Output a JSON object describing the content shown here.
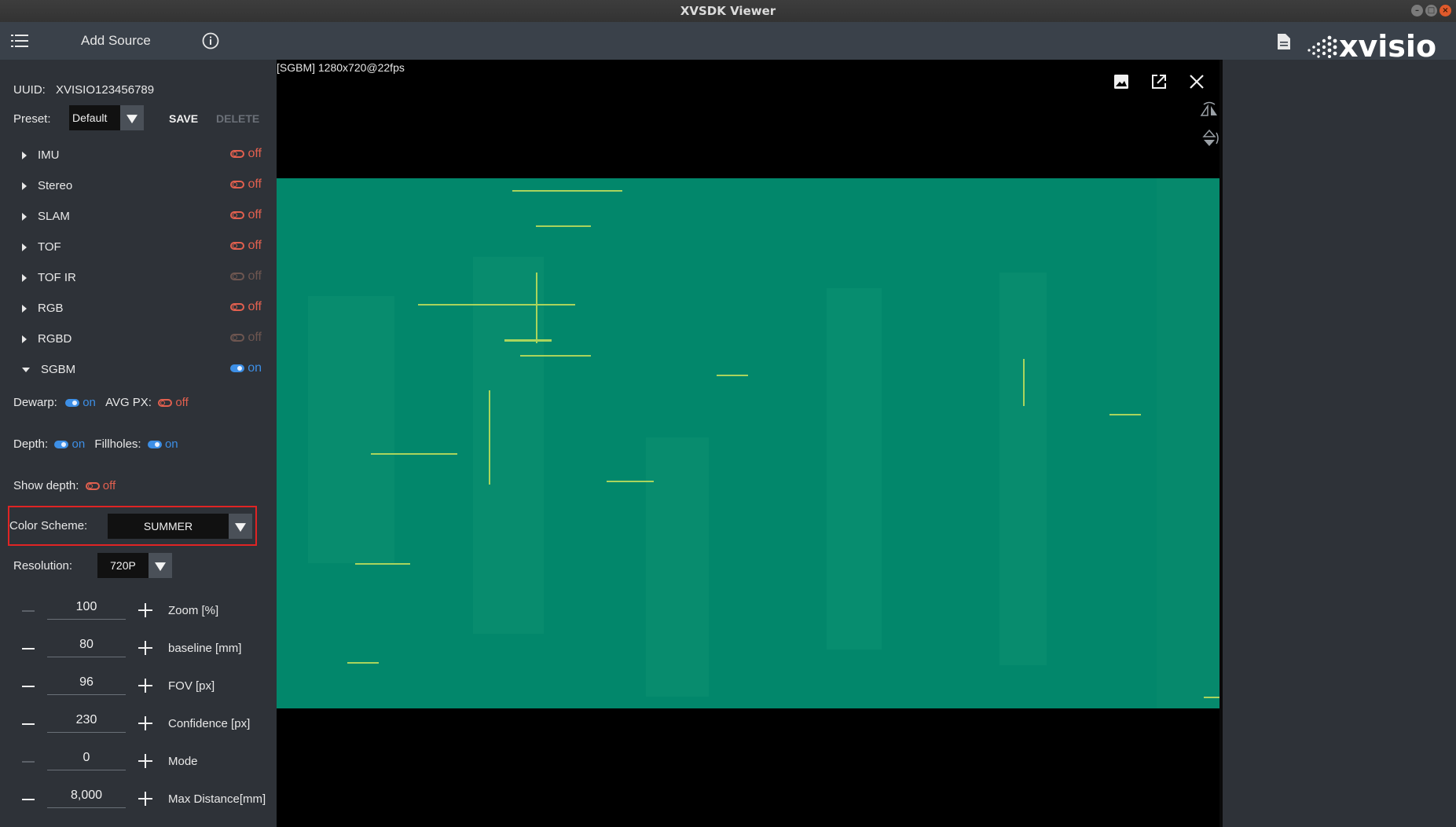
{
  "window": {
    "title": "XVSDK Viewer"
  },
  "toolbar": {
    "add_source_label": "Add Source",
    "brand": "xvisio"
  },
  "device": {
    "uuid_label": "UUID:",
    "uuid_value": "XVISIO123456789"
  },
  "preset": {
    "label": "Preset:",
    "value": "Default",
    "save_label": "SAVE",
    "delete_label": "DELETE"
  },
  "modules": [
    {
      "name": "IMU",
      "state": "off",
      "enabled": true
    },
    {
      "name": "Stereo",
      "state": "off",
      "enabled": true
    },
    {
      "name": "SLAM",
      "state": "off",
      "enabled": true
    },
    {
      "name": "TOF",
      "state": "off",
      "enabled": true
    },
    {
      "name": "TOF IR",
      "state": "off",
      "enabled": false
    },
    {
      "name": "RGB",
      "state": "off",
      "enabled": true
    },
    {
      "name": "RGBD",
      "state": "off",
      "enabled": false
    },
    {
      "name": "SGBM",
      "state": "on",
      "enabled": true,
      "expanded": true
    }
  ],
  "sgbm": {
    "dewarp": {
      "label": "Dewarp:",
      "state": "on"
    },
    "avg_px": {
      "label": "AVG PX:",
      "state": "off"
    },
    "depth": {
      "label": "Depth:",
      "state": "on"
    },
    "fillholes": {
      "label": "Fillholes:",
      "state": "on"
    },
    "show_depth": {
      "label": "Show depth:",
      "state": "off"
    },
    "color_scheme": {
      "label": "Color Scheme:",
      "value": "SUMMER"
    },
    "resolution": {
      "label": "Resolution:",
      "value": "720P"
    },
    "params": [
      {
        "value": "100",
        "label": "Zoom [%]"
      },
      {
        "value": "80",
        "label": "baseline [mm]"
      },
      {
        "value": "96",
        "label": "FOV [px]"
      },
      {
        "value": "230",
        "label": "Confidence [px]"
      },
      {
        "value": "0",
        "label": "Mode"
      },
      {
        "value": "8,000",
        "label": "Max Distance[mm]"
      }
    ]
  },
  "viewer": {
    "stream_label": "[SGBM]  1280x720@22fps"
  },
  "colors": {
    "accent_on": "#3d8fe6",
    "accent_off": "#e2604f",
    "depth_summer": "#02876b",
    "highlight_box": "#e02424"
  },
  "icons": [
    "menu-icon",
    "info-icon",
    "document-icon",
    "image-icon",
    "open-external-icon",
    "close-icon",
    "flip-horizontal-icon",
    "flip-vertical-icon"
  ]
}
